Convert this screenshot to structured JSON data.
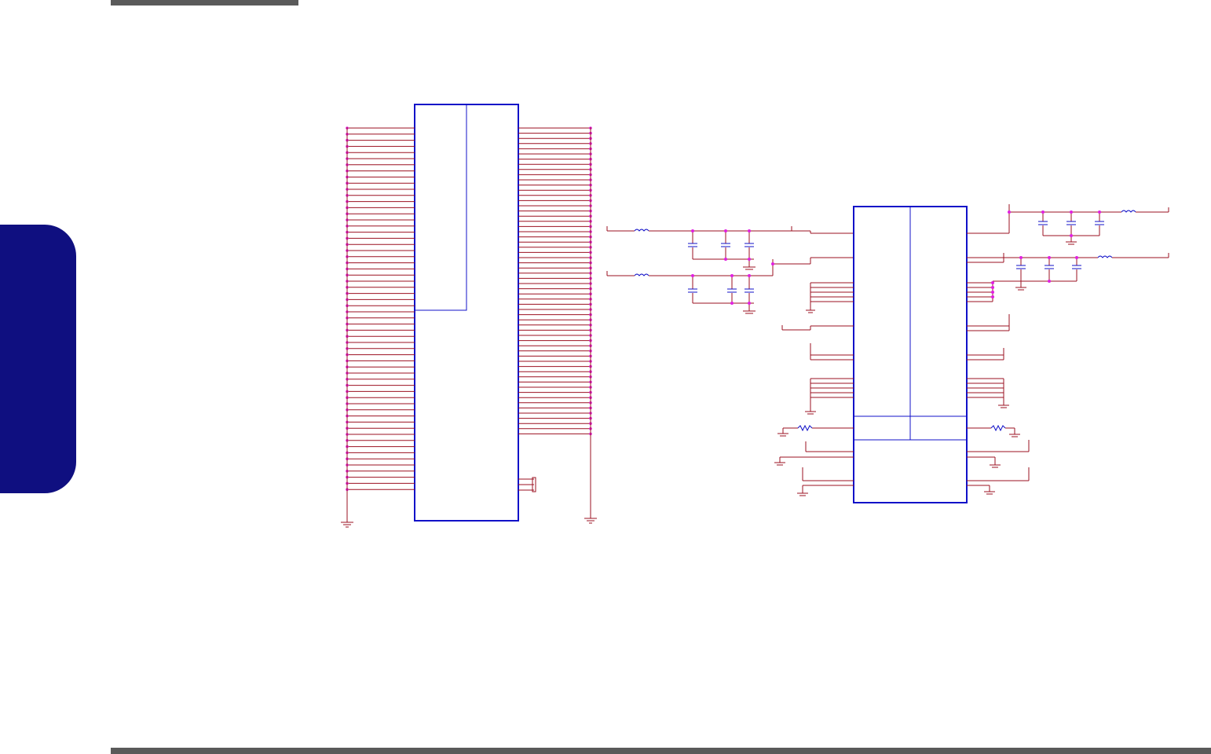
{
  "page": {
    "tab_color": "#0f0f80",
    "bar_color": "#5a5a5a"
  },
  "schematic": {
    "wire_color": "#9b1020",
    "junction_color": "#e020e0",
    "component_color": "#1010c8",
    "left_connector_rows": 60,
    "right_connector_rows": 60
  }
}
